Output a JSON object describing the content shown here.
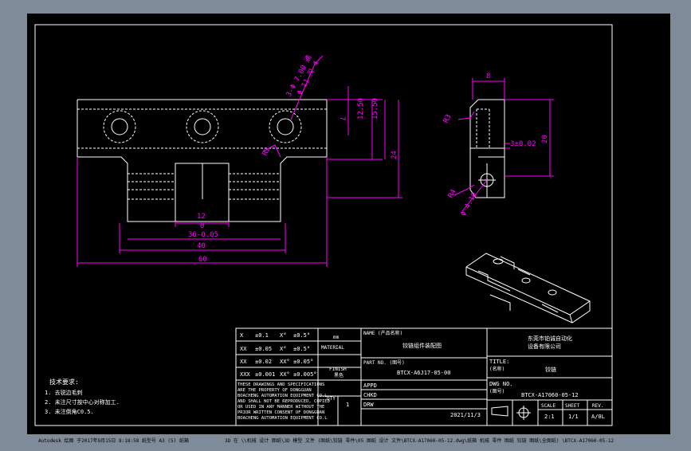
{
  "status_bar": {
    "left": "Autodesk 绘图 于2017年9月15日 8:18:58 纸型号 A3 (5) 纸箱",
    "path": "3D 在 \\\\机械 设计 图纸\\3D 模型 文件 (图纸\\铰链 零件\\05 图纸 设计 文件\\BTCX-A17060-05-12.dwg\\纸箱 机械 零件 图纸 铰链 图纸\\全图纸) \\BTCX-A17060-05-12"
  },
  "dimensions": {
    "hole_spec_1": "3-Φ 7.00 通",
    "hole_spec_2": "Φ 11 深 4",
    "r2": "R2",
    "d7": "7",
    "d12_5": "12.50",
    "d15_5": "15.50",
    "d24": "24",
    "d12": "12",
    "d0": "0",
    "d36": "36-0.05",
    "d40": "40",
    "d60": "60",
    "d8": "8",
    "r3": "R3",
    "d3": "3±0.02",
    "d20": "20",
    "r4": "R4",
    "d4_1": "Φ 4.10"
  },
  "notes": {
    "title": "技术要求:",
    "items": [
      "1. 去锐边毛刺",
      "2. 未注尺寸按中心对称加工.",
      "3. 未注倒角C0.5."
    ]
  },
  "tolerance_table": {
    "rows": [
      [
        "X",
        "±0.1",
        "X°",
        "±0.5°"
      ],
      [
        "XX",
        "±0.05",
        "X°",
        "±0.5°"
      ],
      [
        "XX",
        "±0.02",
        "XX°",
        "±0.05°"
      ],
      [
        "XXX",
        "±0.001",
        "XX°",
        "±0.005°"
      ]
    ]
  },
  "material": {
    "label": "MATERIAL",
    "unit": "mm"
  },
  "finish": {
    "label": "FINISH",
    "value": "黑色"
  },
  "qty": {
    "label": "QTY",
    "value": "1"
  },
  "disclaimer": [
    "THESE DRAWINGS AND SPECIFICATIONS",
    "ARE THE PROPERTY OF DONGGUAN",
    "BOACHENG AUTOMATION EQUIPMENT CO.L",
    "AND SHALL NOT BE REPRODUCED, COPIED",
    "OR USED IN ANY MANNER WITHOUT THE",
    "PRIOR WRITTEN CONSENT OF DONGGUAN",
    "BOACHENG AUTOMATION EQUIPMENT CO.L"
  ],
  "title_block": {
    "name_label": "NAME (产品名称)",
    "name_value": "铰链组件装配图",
    "part_no_label": "PART NO. (图号)",
    "part_no_value": "BTCX-A6J17-05-00",
    "appd": "APPD",
    "chkd": "CHKD",
    "drw": "DRW",
    "date": "2021/11/3",
    "company": [
      "东莞市铂诚自动化",
      "设备有限公司"
    ],
    "title_label": "TITLE:",
    "title_label_cn": "(名称)",
    "title_value": "铰链",
    "dwg_label": "DWG NO.",
    "dwg_label_cn": "(图号)",
    "dwg_value": "BTCX-A17060-05-12",
    "scale_label": "SCALE",
    "scale_value": "2:1",
    "sheet_label": "SHEET",
    "sheet_value": "1/1",
    "rev_label": "REV.",
    "rev_value": "A/0L"
  },
  "colors": {
    "background": "#000000",
    "outer_frame": "#7f8b99",
    "part_lines": "#ffffff",
    "dimension_lines": "#ff00ff"
  }
}
